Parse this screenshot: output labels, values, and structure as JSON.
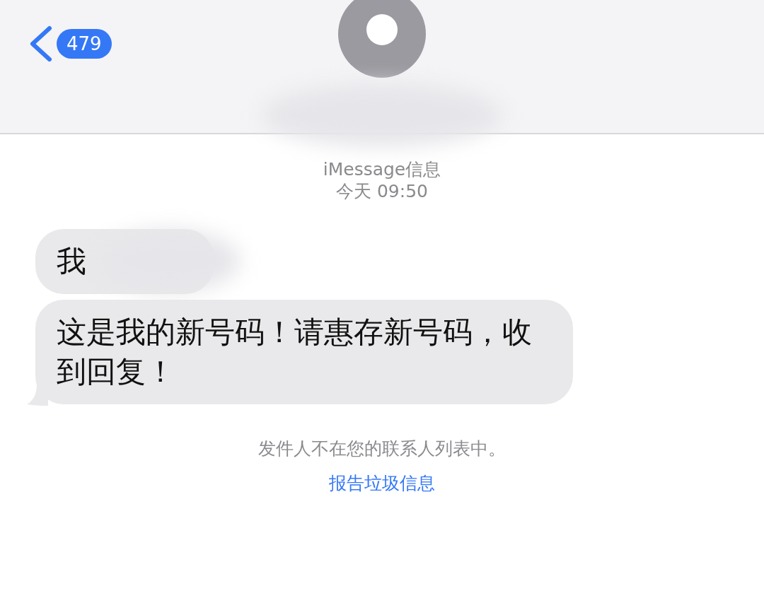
{
  "nav": {
    "back_badge": "479"
  },
  "thread": {
    "service": "iMessage信息",
    "timestamp": "今天 09:50"
  },
  "messages": [
    {
      "text": "我",
      "redacted": true,
      "tail": false
    },
    {
      "text": "这是我的新号码！请惠存新号码，收到回复！",
      "redacted": false,
      "tail": true
    }
  ],
  "notice": {
    "text": "发件人不在您的联系人列表中。",
    "link": "报告垃圾信息"
  }
}
